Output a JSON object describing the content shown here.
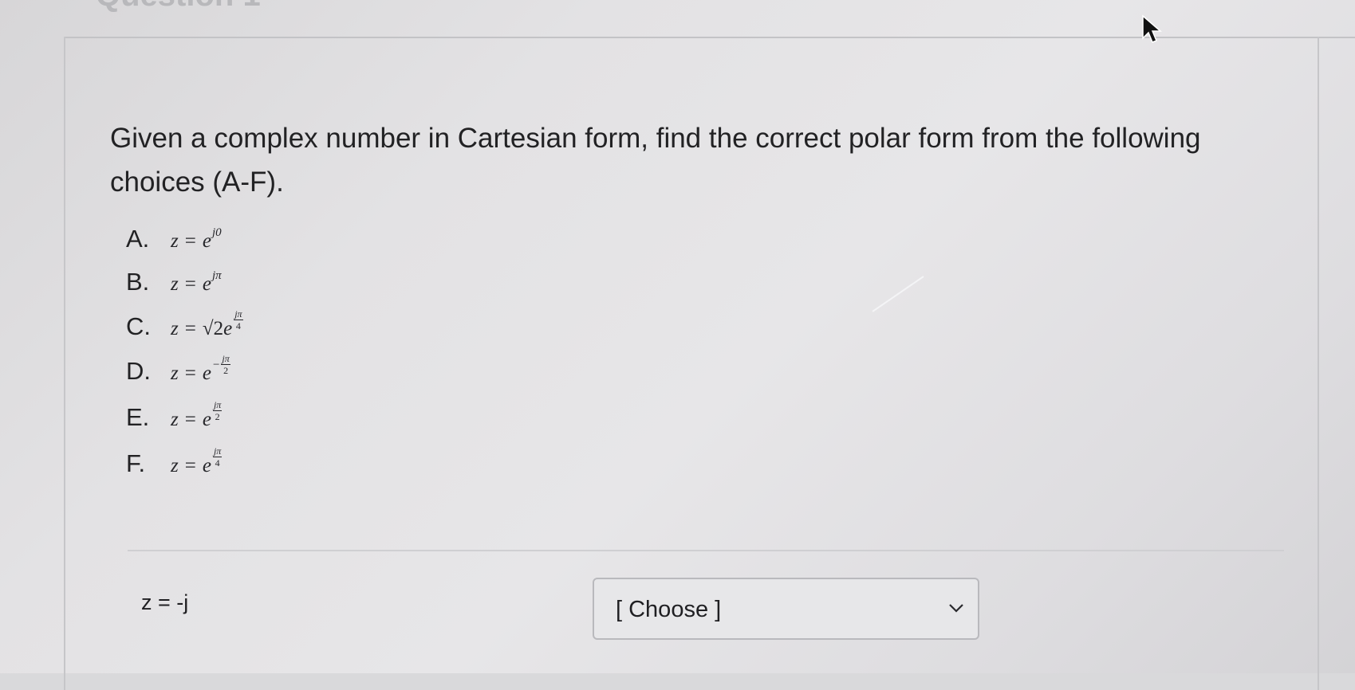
{
  "header": {
    "title": "Question 1"
  },
  "question": {
    "prompt": "Given a complex number in Cartesian form, find the correct polar form from the following choices (A-F).",
    "options": [
      {
        "letter": "A.",
        "lhs": "z",
        "base": "e",
        "exp": "j0"
      },
      {
        "letter": "B.",
        "lhs": "z",
        "base": "e",
        "exp": "jπ"
      },
      {
        "letter": "C.",
        "lhs": "z",
        "coef": "√2",
        "base": "e",
        "exp_num": "jπ",
        "exp_den": "4"
      },
      {
        "letter": "D.",
        "lhs": "z",
        "base": "e",
        "sign": "−",
        "exp_num": "jπ",
        "exp_den": "2"
      },
      {
        "letter": "E.",
        "lhs": "z",
        "base": "e",
        "exp_num": "jπ",
        "exp_den": "2"
      },
      {
        "letter": "F.",
        "lhs": "z",
        "base": "e",
        "exp_num": "jπ",
        "exp_den": "4"
      }
    ]
  },
  "answer": {
    "equation": "z = -j",
    "select_value": "[ Choose ]"
  },
  "icons": {
    "chevron": "chevron-down-icon",
    "cursor": "mouse-pointer-icon"
  },
  "colors": {
    "text": "#222224",
    "border": "#b9b9bd"
  }
}
